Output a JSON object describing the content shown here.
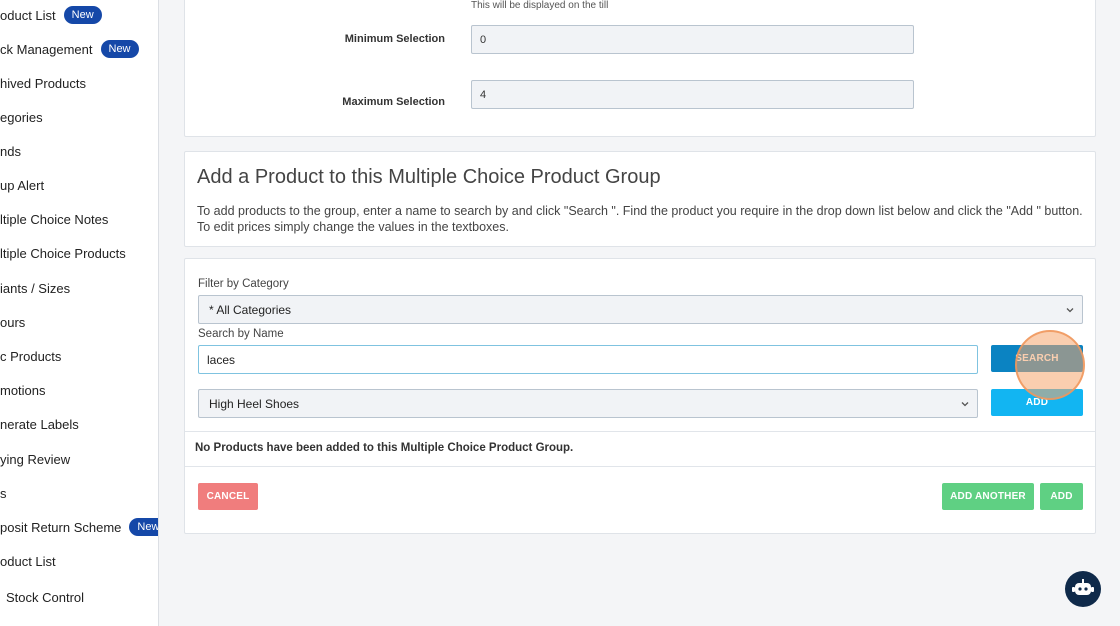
{
  "sidebar": {
    "items": [
      {
        "label": "oduct List",
        "badge": "New"
      },
      {
        "label": "ck Management",
        "badge": "New"
      },
      {
        "label": "hived Products",
        "badge": ""
      },
      {
        "label": "egories",
        "badge": ""
      },
      {
        "label": "nds",
        "badge": ""
      },
      {
        "label": "up Alert",
        "badge": ""
      },
      {
        "label": "ltiple Choice Notes",
        "badge": ""
      },
      {
        "label": "ltiple Choice Products",
        "badge": ""
      },
      {
        "label": "iants / Sizes",
        "badge": ""
      },
      {
        "label": "ours",
        "badge": ""
      },
      {
        "label": "c Products",
        "badge": ""
      },
      {
        "label": "motions",
        "badge": ""
      },
      {
        "label": "nerate Labels",
        "badge": ""
      },
      {
        "label": "ying Review",
        "badge": ""
      },
      {
        "label": "s",
        "badge": ""
      },
      {
        "label": "posit Return Scheme",
        "badge": "New"
      },
      {
        "label": "oduct List",
        "badge": ""
      },
      {
        "label": "Stock Control",
        "badge": ""
      }
    ]
  },
  "top_panel": {
    "hint": "This will be displayed on the till",
    "min_label": "Minimum Selection",
    "min_value": "0",
    "max_label": "Maximum Selection",
    "max_value": "4"
  },
  "info_panel": {
    "title": "Add a Product to this Multiple Choice Product Group",
    "description": "To add products to the group, enter a name to search by and click \"Search \". Find the product you require in the drop down list below and click the \"Add \" button. To edit prices simply change the values in the textboxes."
  },
  "form": {
    "filter_label": "Filter by Category",
    "filter_value": "* All Categories",
    "search_label": "Search by Name",
    "search_value": "laces",
    "search_button": "SEARCH",
    "product_value": "High Heel Shoes",
    "add_button": "ADD",
    "empty_message": "No Products have been added to this Multiple Choice Product Group.",
    "cancel_button": "CANCEL",
    "add_another_button": "ADD ANOTHER",
    "add_final_button": "ADD"
  },
  "colors": {
    "badge": "#1548a8",
    "search_button": "#0b83c2",
    "add_button": "#12b5f2",
    "cancel_button": "#f07d7d",
    "green_button": "#5fd083",
    "chatbot": "#0f2a4a"
  },
  "icons": {
    "chevron": "chevron-down-icon",
    "chatbot": "chatbot-icon"
  }
}
